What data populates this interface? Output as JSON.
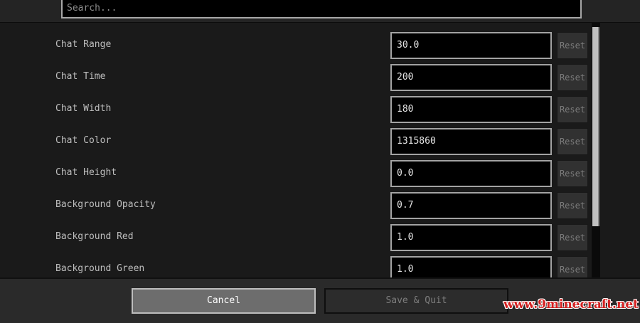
{
  "search": {
    "placeholder": "Search..."
  },
  "settings": [
    {
      "label": "Chat Range",
      "value": "30.0",
      "reset": "Reset"
    },
    {
      "label": "Chat Time",
      "value": "200",
      "reset": "Reset"
    },
    {
      "label": "Chat Width",
      "value": "180",
      "reset": "Reset"
    },
    {
      "label": "Chat Color",
      "value": "1315860",
      "reset": "Reset"
    },
    {
      "label": "Chat Height",
      "value": "0.0",
      "reset": "Reset"
    },
    {
      "label": "Background Opacity",
      "value": "0.7",
      "reset": "Reset"
    },
    {
      "label": "Background Red",
      "value": "1.0",
      "reset": "Reset"
    },
    {
      "label": "Background Green",
      "value": "1.0",
      "reset": "Reset"
    }
  ],
  "footer": {
    "cancel_label": "Cancel",
    "save_label": "Save & Quit"
  },
  "watermark": "www.9minecraft.net",
  "scroll_position": 0.0
}
